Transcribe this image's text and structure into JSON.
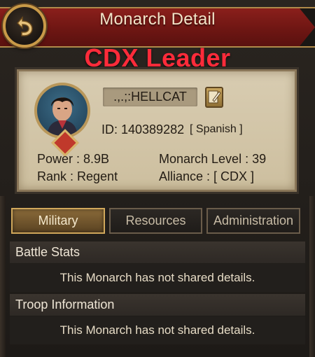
{
  "header": {
    "title": "Monarch Detail"
  },
  "overlay": {
    "label": "CDX Leader"
  },
  "profile": {
    "name": ".,.;:HELLCAT",
    "id_text": "ID: 140389282",
    "language_text": "[ Spanish ]",
    "power_text": "Power : 8.9B",
    "rank_text": "Rank : Regent",
    "level_text": "Monarch Level : 39",
    "alliance_text": "Alliance :  [ CDX ]"
  },
  "tabs": [
    {
      "label": "Military",
      "active": true
    },
    {
      "label": "Resources",
      "active": false
    },
    {
      "label": "Administration",
      "active": false
    }
  ],
  "sections": [
    {
      "title": "Battle Stats",
      "body": "This Monarch has not shared details."
    },
    {
      "title": "Troop Information",
      "body": "This Monarch has not shared details."
    }
  ],
  "colors": {
    "banner": "#6e1613",
    "gold": "#c99a48",
    "overlay_text": "#ff2b3a",
    "parchment": "#d8ccb1"
  },
  "icons": {
    "back": "back-arrow-icon",
    "edit": "quill-edit-icon",
    "avatar_badge": "rank-badge-icon"
  }
}
